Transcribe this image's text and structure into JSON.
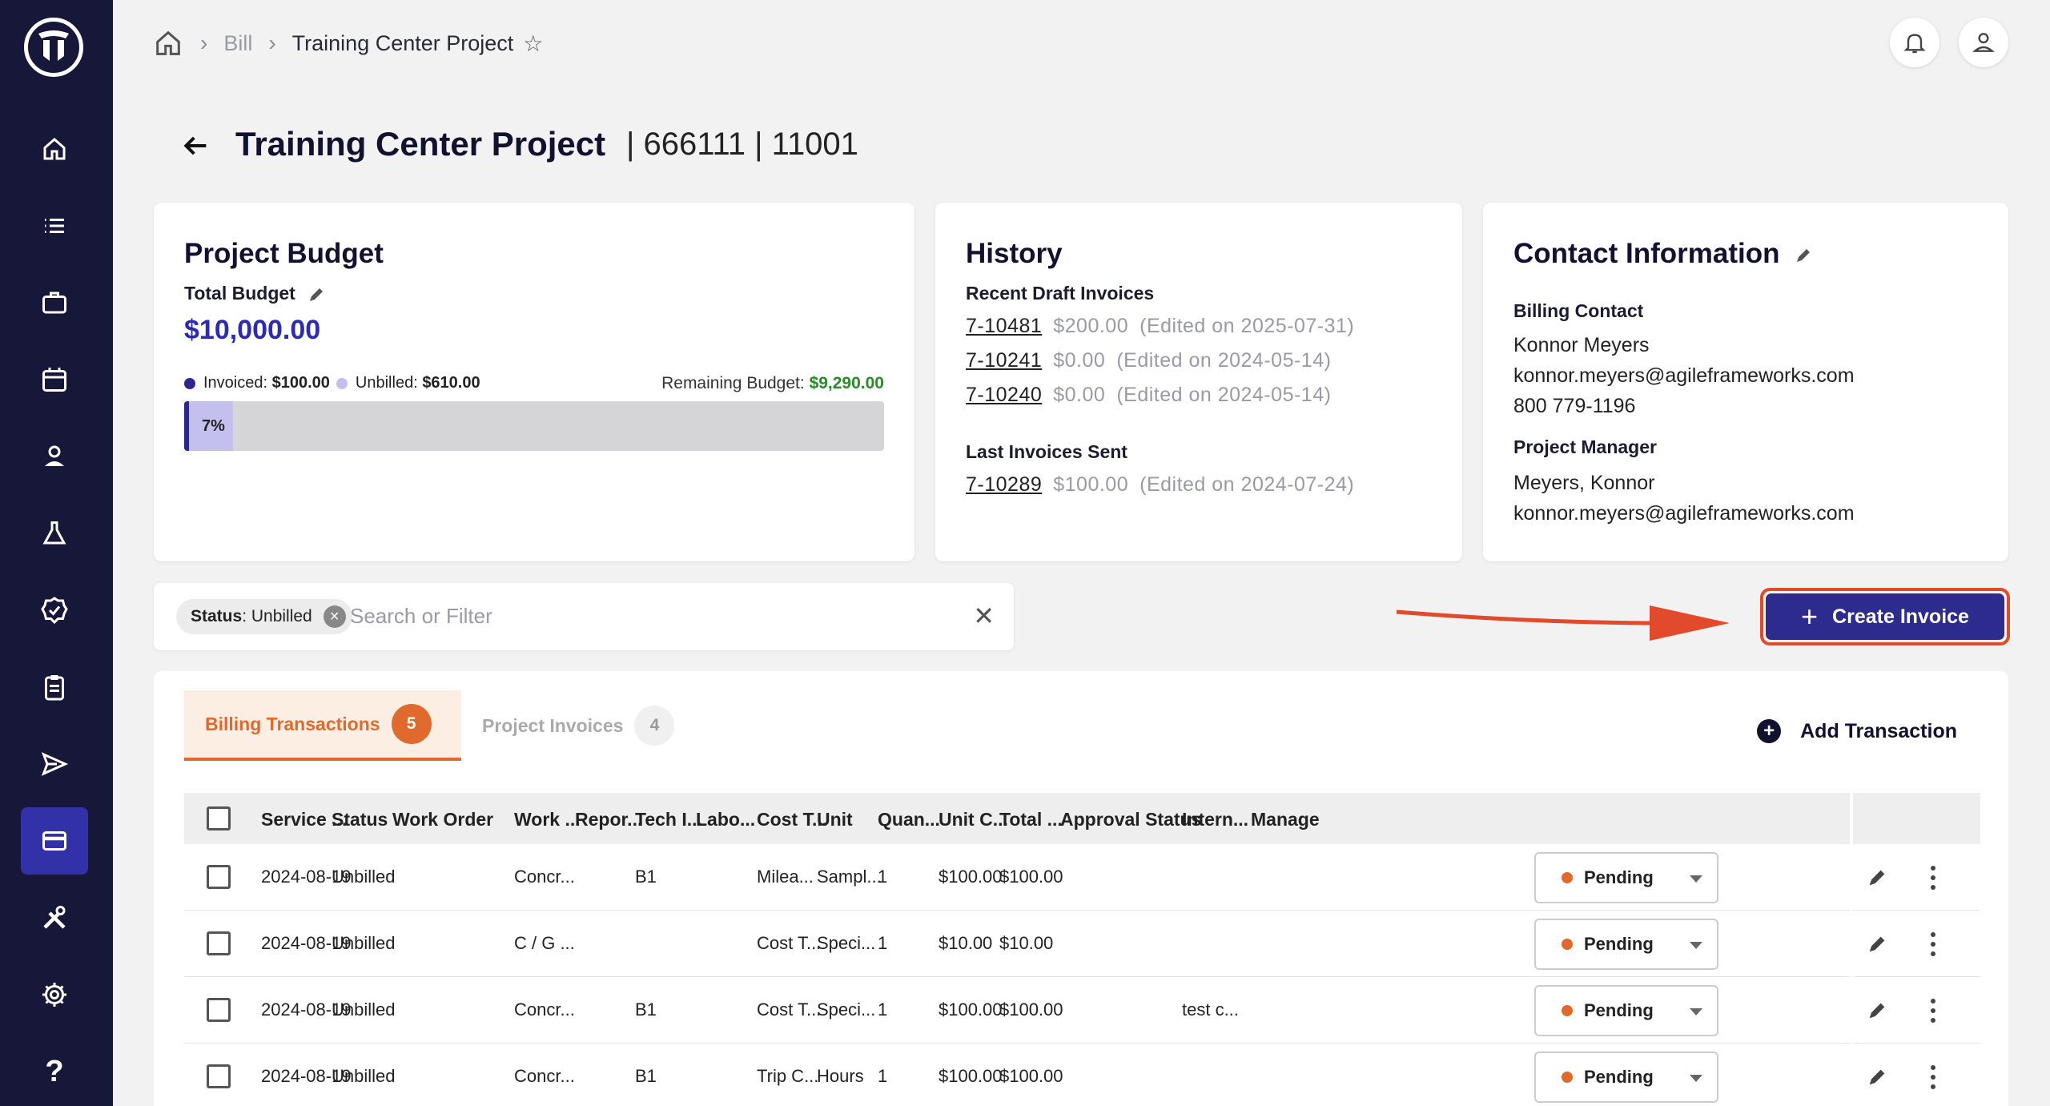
{
  "breadcrumb": {
    "level1": "Bill",
    "current": "Training Center Project"
  },
  "page": {
    "title": "Training Center Project",
    "subtitle": "| 666111 | 11001"
  },
  "budget": {
    "heading": "Project Budget",
    "total_label": "Total Budget",
    "total_value": "$10,000.00",
    "invoiced_label": "Invoiced:",
    "invoiced_value": "$100.00",
    "unbilled_label": "Unbilled:",
    "unbilled_value": "$610.00",
    "remaining_label": "Remaining Budget:",
    "remaining_value": "$9,290.00",
    "progress_percent_label": "7%",
    "progress_fraction": 0.07,
    "colors": {
      "invoiced": "#2a2890",
      "unbilled": "#c3c0ee",
      "remaining": "#2a8a2a"
    }
  },
  "history": {
    "heading": "History",
    "drafts_label": "Recent Draft Invoices",
    "drafts": [
      {
        "id": "7-10481",
        "amount": "$200.00",
        "edited": "(Edited on 2025-07-31)"
      },
      {
        "id": "7-10241",
        "amount": "$0.00",
        "edited": "(Edited on 2024-05-14)"
      },
      {
        "id": "7-10240",
        "amount": "$0.00",
        "edited": "(Edited on 2024-05-14)"
      }
    ],
    "sent_label": "Last Invoices Sent",
    "sent": [
      {
        "id": "7-10289",
        "amount": "$100.00",
        "edited": "(Edited on 2024-07-24)"
      }
    ]
  },
  "contact": {
    "heading": "Contact Information",
    "billing_label": "Billing Contact",
    "billing_name": "Konnor Meyers",
    "billing_email": "konnor.meyers@agileframeworks.com",
    "billing_phone": "800 779-1196",
    "pm_label": "Project Manager",
    "pm_name": "Meyers, Konnor",
    "pm_email": "konnor.meyers@agileframeworks.com"
  },
  "filter": {
    "chip_key": "Status",
    "chip_value": ": Unbilled",
    "placeholder": "Search or Filter"
  },
  "actions": {
    "create_invoice": "Create Invoice",
    "add_transaction": "Add Transaction"
  },
  "tabs": [
    {
      "label": "Billing Transactions",
      "count": "5"
    },
    {
      "label": "Project Invoices",
      "count": "4"
    }
  ],
  "table": {
    "headers": [
      "Service ...",
      "Status",
      "Work Order",
      "Work ...",
      "Repor...",
      "Tech I...",
      "Labo...",
      "Cost T...",
      "Unit",
      "Quan...",
      "Unit C...",
      "Total ...",
      "Approval Status",
      "Intern...",
      "Manage"
    ],
    "rows": [
      {
        "date": "2024-08-19",
        "status": "Unbilled",
        "work_order": "",
        "work": "Concr...",
        "report": "",
        "tech": "B1",
        "labor": "",
        "cost_type": "Milea...",
        "unit": "Sampl...",
        "qty": "1",
        "unit_cost": "$100.00",
        "total": "$100.00",
        "approval": "Pending",
        "internal": ""
      },
      {
        "date": "2024-08-19",
        "status": "Unbilled",
        "work_order": "",
        "work": "C / G ...",
        "report": "",
        "tech": "",
        "labor": "",
        "cost_type": "Cost T...",
        "unit": "Speci...",
        "qty": "1",
        "unit_cost": "$10.00",
        "total": "$10.00",
        "approval": "Pending",
        "internal": ""
      },
      {
        "date": "2024-08-19",
        "status": "Unbilled",
        "work_order": "",
        "work": "Concr...",
        "report": "",
        "tech": "B1",
        "labor": "",
        "cost_type": "Cost T...",
        "unit": "Speci...",
        "qty": "1",
        "unit_cost": "$100.00",
        "total": "$100.00",
        "approval": "Pending",
        "internal": "test c..."
      },
      {
        "date": "2024-08-19",
        "status": "Unbilled",
        "work_order": "",
        "work": "Concr...",
        "report": "",
        "tech": "B1",
        "labor": "",
        "cost_type": "Trip C...",
        "unit": "Hours",
        "qty": "1",
        "unit_cost": "$100.00",
        "total": "$100.00",
        "approval": "Pending",
        "internal": ""
      }
    ]
  },
  "icons": {
    "sidebar": [
      "home-icon",
      "list-icon",
      "briefcase-icon",
      "calendar-icon",
      "person-badge-icon",
      "flask-icon",
      "badge-check-icon",
      "clipboard-icon",
      "send-icon",
      "credit-card-icon",
      "tools-icon",
      "gear-icon",
      "help-icon"
    ],
    "active_sidebar": "credit-card-icon"
  }
}
